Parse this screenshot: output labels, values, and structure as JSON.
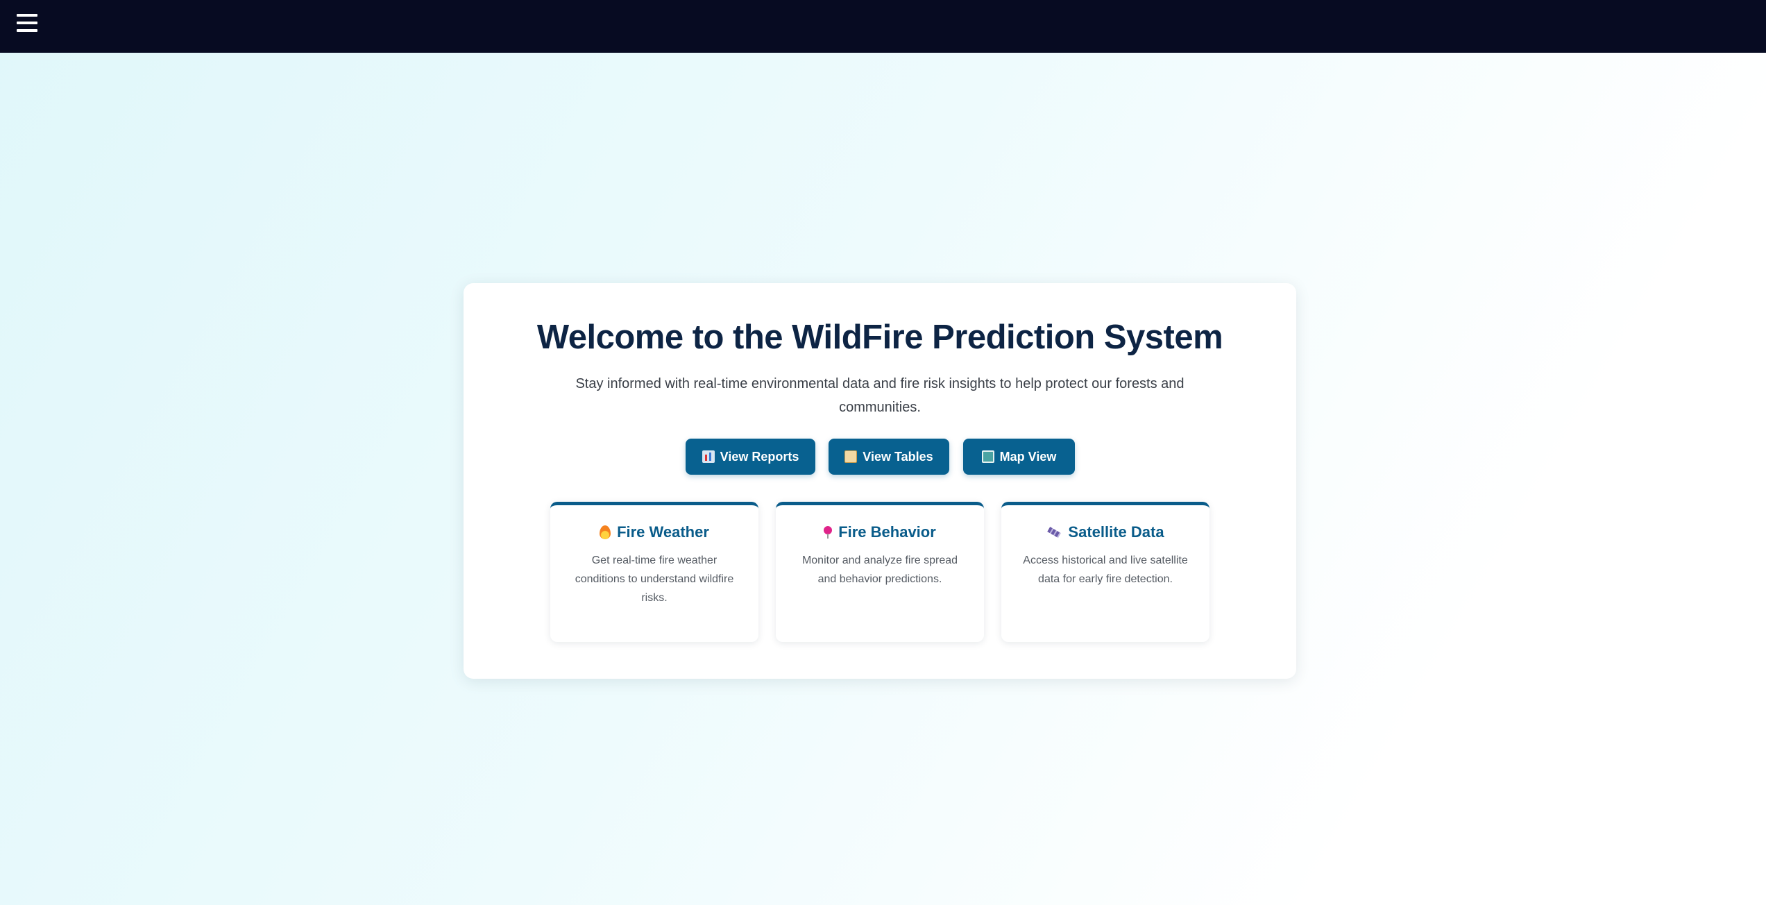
{
  "header": {
    "menu_icon": "hamburger-menu-icon",
    "background_color": "#070b22"
  },
  "welcome": {
    "title": "Welcome to the WildFire Prediction System",
    "subtitle": "Stay informed with real-time environmental data and fire risk insights to help protect our forests and communities."
  },
  "actions": [
    {
      "label": "View Reports",
      "icon": "bar-chart-icon"
    },
    {
      "label": "View Tables",
      "icon": "scroll-icon"
    },
    {
      "label": "Map View",
      "icon": "map-icon"
    }
  ],
  "features": [
    {
      "title": "Fire Weather",
      "icon": "flame-icon",
      "description": "Get real-time fire weather conditions to understand wildfire risks."
    },
    {
      "title": "Fire Behavior",
      "icon": "pushpin-icon",
      "description": "Monitor and analyze fire spread and behavior predictions."
    },
    {
      "title": "Satellite Data",
      "icon": "satellite-icon",
      "description": "Access historical and live satellite data for early fire detection."
    }
  ],
  "colors": {
    "accent": "#086190",
    "title": "#0d2444",
    "card_border": "#0a5c8a"
  }
}
